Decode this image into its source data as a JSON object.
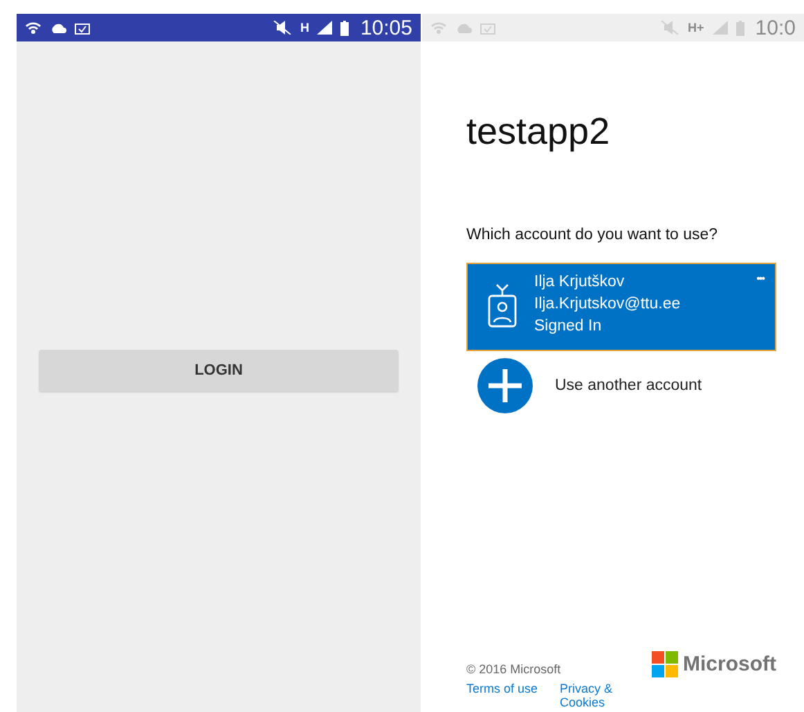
{
  "left_screen": {
    "status_bar": {
      "time": "10:05",
      "network": "H"
    },
    "login_button": {
      "label": "LOGIN"
    }
  },
  "right_screen": {
    "status_bar": {
      "time": "10:0",
      "network": "H+"
    },
    "app_title": "testapp2",
    "prompt": "Which account do you want to use?",
    "accounts": [
      {
        "kind": "account",
        "name": "Ilja Krjutškov",
        "email": "Ilja.Krjutskov@ttu.ee",
        "status": "Signed In",
        "more": "•••",
        "selected": true
      },
      {
        "kind": "add",
        "label": "Use another account",
        "selected": false
      }
    ],
    "footer": {
      "copyright": "© 2016 Microsoft",
      "links": [
        "Terms of use",
        "Privacy & Cookies"
      ],
      "brand": "Microsoft"
    }
  }
}
